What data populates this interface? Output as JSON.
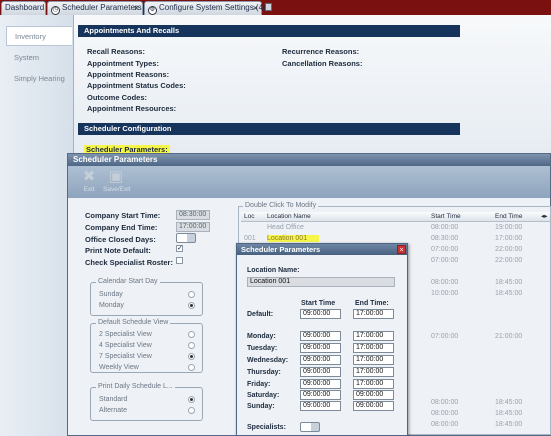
{
  "tabs": [
    {
      "label": "Dashboard"
    },
    {
      "label": "Scheduler Parameters"
    },
    {
      "label": "Configure System Settings (4)"
    }
  ],
  "sidebar": {
    "items": [
      {
        "label": "Inventory"
      },
      {
        "label": "System"
      },
      {
        "label": "Simply Hearing"
      }
    ]
  },
  "appointments": {
    "header": "Appointments And Recalls",
    "left": [
      "Recall Reasons:",
      "Appointment Types:",
      "Appointment Reasons:",
      "Appointment Status Codes:",
      "Outcome Codes:",
      "Appointment Resources:"
    ],
    "right": [
      "Recurrence Reasons:",
      "Cancellation Reasons:"
    ]
  },
  "scheduler_config": {
    "header": "Scheduler Configuration",
    "param_label": "Scheduler Parameters:"
  },
  "window": {
    "title": "Scheduler Parameters",
    "toolbar": {
      "exit": "Exit",
      "save_exit": "Save/Exit"
    },
    "company_start_label": "Company Start Time:",
    "company_start_value": "08:30:00",
    "company_end_label": "Company End Time:",
    "company_end_value": "17:00:00",
    "office_closed_label": "Office Closed Days:",
    "print_note_label": "Print Note Default:",
    "print_note_checked": "✓",
    "check_roster_label": "Check Specialist Roster:",
    "calendar_group": {
      "title": "Calendar Start Day",
      "options": [
        "Sunday",
        "Monday"
      ]
    },
    "schedule_group": {
      "title": "Default Schedule View",
      "options": [
        "2 Specialist View",
        "4 Specialist View",
        "7 Specialist View",
        "Weekly View"
      ]
    },
    "print_group": {
      "title": "Print Daily Schedule L...",
      "options": [
        "Standard",
        "Alternate"
      ]
    }
  },
  "grid": {
    "caption": "Double Click To Modify",
    "columns": [
      "Loc",
      "Location Name",
      "Start Time",
      "End Time"
    ],
    "rows": [
      {
        "loc": "",
        "name": "Head Office",
        "start": "08:00:00",
        "end": "19:00:00"
      },
      {
        "loc": "001",
        "name": "Location 001",
        "start": "08:30:00",
        "end": "17:00:00"
      },
      {
        "loc": "",
        "name": "",
        "start": "07:00:00",
        "end": "22:00:00"
      },
      {
        "loc": "",
        "name": "",
        "start": "07:00:00",
        "end": "22:00:00"
      },
      {
        "loc": "",
        "name": "",
        "start": "08:00:00",
        "end": "18:45:00"
      },
      {
        "loc": "",
        "name": "",
        "start": "10:00:00",
        "end": "18:45:00"
      },
      {
        "loc": "",
        "name": "",
        "start": "07:00:00",
        "end": "21:00:00"
      },
      {
        "loc": "",
        "name": "",
        "start": "08:00:00",
        "end": "18:45:00"
      },
      {
        "loc": "",
        "name": "",
        "start": "08:00:00",
        "end": "18:45:00"
      },
      {
        "loc": "",
        "name": "",
        "start": "08:00:00",
        "end": "18:45:00"
      }
    ]
  },
  "dialog": {
    "title": "Scheduler Parameters",
    "location_label": "Location Name:",
    "location_value": "Location 001",
    "start_header": "Start Time",
    "end_header": "End Time:",
    "default_label": "Default:",
    "default_start": "09:00:00",
    "default_end": "17:00:00",
    "days": [
      {
        "label": "Monday:",
        "start": "09:00:00",
        "end": "17:00:00"
      },
      {
        "label": "Tuesday:",
        "start": "09:00:00",
        "end": "17:00:00"
      },
      {
        "label": "Wednesday:",
        "start": "09:00:00",
        "end": "17:00:00"
      },
      {
        "label": "Thursday:",
        "start": "09:00:00",
        "end": "17:00:00"
      },
      {
        "label": "Friday:",
        "start": "09:00:00",
        "end": "17:00:00"
      },
      {
        "label": "Saturday:",
        "start": "09:00:00",
        "end": "09:00:00"
      },
      {
        "label": "Sunday:",
        "start": "09:00:00",
        "end": "09:00:00"
      }
    ],
    "specialists_label": "Specialists:"
  }
}
